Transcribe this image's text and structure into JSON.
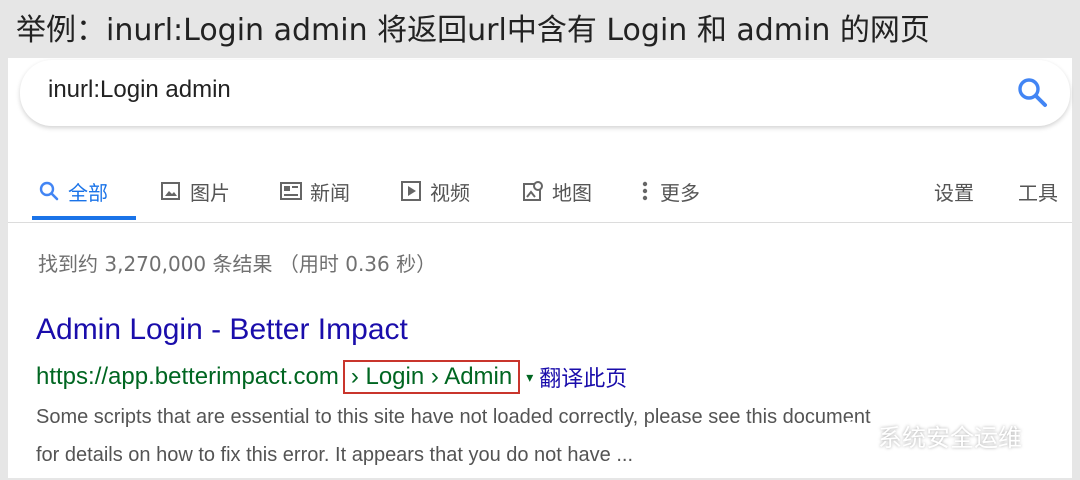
{
  "caption": "举例：inurl:Login admin  将返回url中含有 Login 和 admin 的网页",
  "search": {
    "query": "inurl:Login admin",
    "button_icon": "search-icon"
  },
  "tabs": [
    {
      "label": "全部",
      "icon": "search-icon",
      "active": true
    },
    {
      "label": "图片",
      "icon": "image-icon"
    },
    {
      "label": "新闻",
      "icon": "news-icon"
    },
    {
      "label": "视频",
      "icon": "video-icon"
    },
    {
      "label": "地图",
      "icon": "map-icon"
    },
    {
      "label": "更多",
      "icon": "more-vert-icon"
    },
    {
      "label": "设置"
    },
    {
      "label": "工具"
    }
  ],
  "stats": "找到约 3,270,000 条结果 （用时 0.36 秒）",
  "result": {
    "title": "Admin Login - Better Impact",
    "url": "https://app.betterimpact.com",
    "breadcrumb": "› Login › Admin",
    "caret": "▾",
    "translate": "翻译此页",
    "snippet_line1": "Some scripts that are essential to this site have not loaded correctly, please see this document",
    "snippet_line2": "for details on how to fix this error. It appears that you do not have ..."
  },
  "watermark": "系统安全运维",
  "colors": {
    "accent": "#1a73e8",
    "link": "#1a0dab",
    "url_green": "#006621",
    "highlight_box": "#c9352c"
  }
}
